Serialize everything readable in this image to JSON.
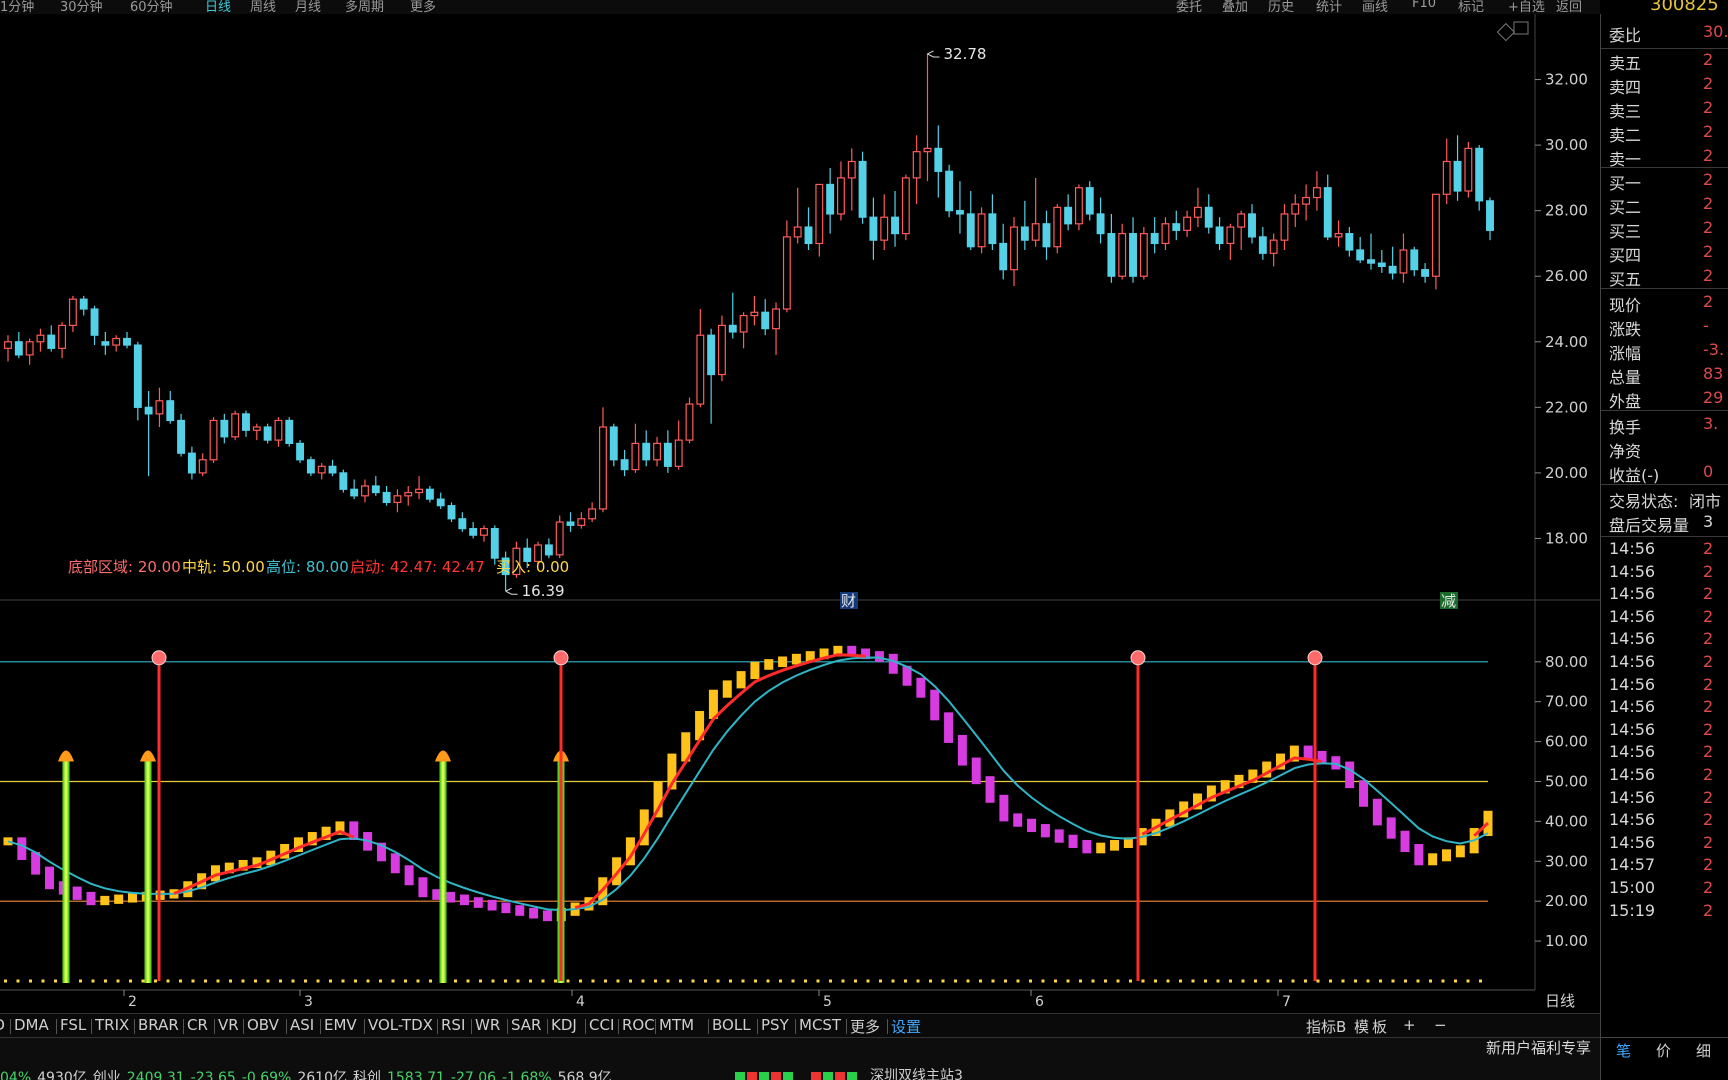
{
  "topbar": {
    "items": [
      "1分钟",
      "30分钟",
      "60分钟",
      "日线",
      "周线",
      "月线",
      "多周期",
      "更多"
    ],
    "active_index": 3,
    "right_items": [
      "委托",
      "叠加",
      "历史",
      "统计",
      "画线",
      "F10",
      "标记",
      "+自选",
      "返回"
    ],
    "stock_code": "300825"
  },
  "main_chart": {
    "y_ticks": [
      "32.00",
      "30.00",
      "28.00",
      "26.00",
      "24.00",
      "22.00",
      "20.00",
      "18.00"
    ],
    "high_label": "32.78",
    "low_label": "16.39",
    "marker_cai": "财",
    "marker_jian": "减",
    "colors": {
      "up": "#ff5b5b",
      "down": "#54d1e6",
      "bg": "#000000"
    }
  },
  "indicator": {
    "legend": [
      {
        "text": "底部区域: 20.00",
        "color": "#ff6e6e"
      },
      {
        "text": "中轨: 50.00",
        "color": "#ffd84a"
      },
      {
        "text": "高位: 80.00",
        "color": "#3fc0d0"
      },
      {
        "text": "启动: 42.47",
        "color": "#ff3535"
      },
      {
        "text": ": 42.47",
        "color": "#ff3535"
      },
      {
        "text": "买入: 0.00",
        "color": "#ffd84a"
      }
    ],
    "y_ticks": [
      "80.00",
      "70.00",
      "60.00",
      "50.00",
      "40.00",
      "30.00",
      "20.00",
      "10.00"
    ]
  },
  "x_axis": {
    "labels": [
      "2",
      "3",
      "4",
      "5",
      "6",
      "7"
    ],
    "period_label": "日线"
  },
  "bottom_tabs": {
    "items": [
      "MACD",
      "DMA",
      "FSL",
      "TRIX",
      "BRAR",
      "CR",
      "VR",
      "OBV",
      "ASI",
      "EMV",
      "VOL-TDX",
      "RSI",
      "WR",
      "SAR",
      "KDJ",
      "CCI",
      "ROC",
      "MTM",
      "BOLL",
      "PSY",
      "MCST",
      "更多",
      "设置"
    ],
    "active_index": 22,
    "right_buttons": [
      "指标B",
      "模",
      "板",
      "+",
      "−"
    ]
  },
  "right_panel": {
    "weibi_label": "委比",
    "weibi_value": "30.",
    "sell": [
      {
        "label": "卖五",
        "value": "2"
      },
      {
        "label": "卖四",
        "value": "2"
      },
      {
        "label": "卖三",
        "value": "2"
      },
      {
        "label": "卖二",
        "value": "2"
      },
      {
        "label": "卖一",
        "value": "2"
      }
    ],
    "buy": [
      {
        "label": "买一",
        "value": "2"
      },
      {
        "label": "买二",
        "value": "2"
      },
      {
        "label": "买三",
        "value": "2"
      },
      {
        "label": "买四",
        "value": "2"
      },
      {
        "label": "买五",
        "value": "2"
      }
    ],
    "quote": [
      {
        "label": "现价",
        "value": "2"
      },
      {
        "label": "涨跌",
        "value": "-"
      },
      {
        "label": "涨幅",
        "value": "-3."
      },
      {
        "label": "总量",
        "value": "83"
      },
      {
        "label": "外盘",
        "value": "29"
      }
    ],
    "extra": [
      {
        "label": "换手",
        "value": "3."
      },
      {
        "label": "净资",
        "value": ""
      },
      {
        "label": "收益(-)",
        "value": "0"
      }
    ],
    "trade_state_label": "交易状态:",
    "trade_state_value": "闭市",
    "after_hours_label": "盘后交易量",
    "after_hours_value": "3",
    "ticks": [
      "14:56",
      "14:56",
      "14:56",
      "14:56",
      "14:56",
      "14:56",
      "14:56",
      "14:56",
      "14:56",
      "14:56",
      "14:56",
      "14:56",
      "14:56",
      "14:56",
      "14:57",
      "15:00",
      "15:19"
    ],
    "tick_value": "2"
  },
  "corner_tabs": [
    "笔",
    "价",
    "细"
  ],
  "statusbar": {
    "segments": [
      {
        "text": "04%",
        "color": "#46d26a"
      },
      {
        "text": "4930亿",
        "color": "#d0d0d0"
      },
      {
        "text": "创业",
        "color": "#d0d0d0"
      },
      {
        "text": "2409.31",
        "color": "#46d26a"
      },
      {
        "text": "-23.65",
        "color": "#46d26a"
      },
      {
        "text": "-0.69%",
        "color": "#46d26a"
      },
      {
        "text": "2610亿",
        "color": "#d0d0d0"
      },
      {
        "text": "科创",
        "color": "#d0d0d0"
      },
      {
        "text": "1583.71",
        "color": "#46d26a"
      },
      {
        "text": "-27.06",
        "color": "#46d26a"
      },
      {
        "text": "-1.68%",
        "color": "#46d26a"
      },
      {
        "text": "568.9亿",
        "color": "#d0d0d0"
      }
    ],
    "right_text": "深圳双线主站3",
    "notice": "新用户福利专享"
  }
}
